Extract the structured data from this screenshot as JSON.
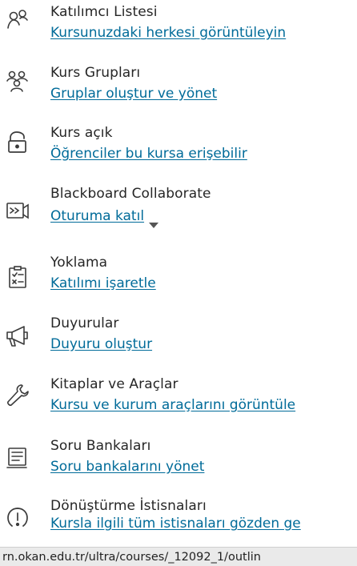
{
  "items": [
    {
      "title": "Katılımcı Listesi",
      "link": "Kursunuzdaki herkesi görüntüleyin",
      "icon": "roster-icon"
    },
    {
      "title": "Kurs Grupları",
      "link": "Gruplar oluştur ve yönet",
      "icon": "groups-icon"
    },
    {
      "title": "Kurs açık",
      "link": "Öğrenciler bu kursa erişebilir",
      "icon": "unlock-icon"
    },
    {
      "title": "Blackboard Collaborate",
      "link": "Oturuma katıl",
      "icon": "collaborate-icon"
    },
    {
      "title": "Yoklama",
      "link": "Katılımı işaretle",
      "icon": "attendance-icon"
    },
    {
      "title": "Duyurular",
      "link": "Duyuru oluştur",
      "icon": "megaphone-icon"
    },
    {
      "title": "Kitaplar ve Araçlar",
      "link": "Kursu ve kurum araçlarını görüntüle",
      "icon": "tools-icon"
    },
    {
      "title": "Soru Bankaları",
      "link": "Soru bankalarını yönet",
      "icon": "question-bank-icon"
    },
    {
      "title": "Dönüştürme İstisnaları",
      "link": "Kursla ilgili tüm istisnaları gözden ge",
      "icon": "conversion-icon"
    }
  ],
  "status_url": "rn.okan.edu.tr/ultra/courses/_12092_1/outlin",
  "colors": {
    "link": "#006b99",
    "text": "#262626",
    "icon": "#3b3b3b"
  }
}
